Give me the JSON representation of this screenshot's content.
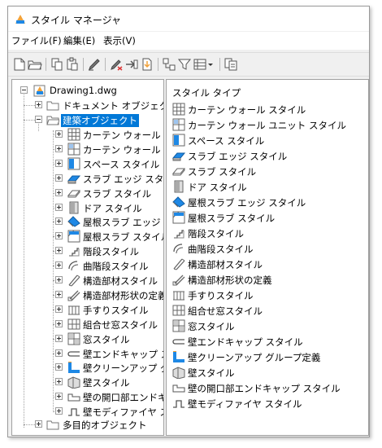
{
  "window": {
    "title": "スタイル マネージャ"
  },
  "menu": {
    "items": [
      "ファイル(F)",
      "編集(E)",
      "表示(V)"
    ]
  },
  "toolbar": {
    "buttons": [
      "new-icon",
      "open-icon",
      "copy-icon",
      "paste-icon",
      "edit-style-icon",
      "purge-icon",
      "send-icon",
      "import-icon",
      "toggle-view-icon",
      "filter-icon",
      "view-mode-icon",
      "dropdown-icon",
      "properties-icon"
    ]
  },
  "tree": {
    "root": "Drawing1.dwg",
    "document_objects": "ドキュメント オブジェクト",
    "architectural_objects": "建築オブジェクト",
    "children": [
      "カーテン ウォール スタイル",
      "カーテン ウォール ユニット",
      "スペース スタイル",
      "スラブ エッジ スタイル",
      "スラブ スタイル",
      "ドア スタイル",
      "屋根スラブ エッジ スタイル",
      "屋根スラブ スタイル",
      "階段スタイル",
      "曲階段スタイル",
      "構造部材スタイル",
      "構造部材形状の定義",
      "手すりスタイル",
      "組合せ窓スタイル",
      "窓スタイル",
      "壁エンドキャップ スタイル",
      "壁クリーンアップ グループ",
      "壁スタイル",
      "壁の開口部エンドキャップ",
      "壁モディファイヤ スタイル"
    ],
    "multipurpose_objects": "多目的オブジェクト"
  },
  "style_list": {
    "header": "スタイル タイプ",
    "items": [
      "カーテン ウォール スタイル",
      "カーテン ウォール ユニット スタイル",
      "スペース スタイル",
      "スラブ エッジ スタイル",
      "スラブ スタイル",
      "ドア スタイル",
      "屋根スラブ エッジ スタイル",
      "屋根スラブ スタイル",
      "階段スタイル",
      "曲階段スタイル",
      "構造部材スタイル",
      "構造部材形状の定義",
      "手すりスタイル",
      "組合せ窓スタイル",
      "窓スタイル",
      "壁エンドキャップ スタイル",
      "壁クリーンアップ グループ定義",
      "壁スタイル",
      "壁の開口部エンドキャップ スタイル",
      "壁モディファイヤ スタイル"
    ]
  },
  "icons": [
    "curtain-wall-icon",
    "curtain-wall-unit-icon",
    "space-icon",
    "slab-edge-icon",
    "slab-icon",
    "door-icon",
    "roof-slab-edge-icon",
    "roof-slab-icon",
    "stair-icon",
    "curved-stair-icon",
    "member-icon",
    "member-shape-icon",
    "railing-icon",
    "window-assembly-icon",
    "window-icon",
    "wall-endcap-icon",
    "wall-cleanup-icon",
    "wall-icon",
    "opening-endcap-icon",
    "wall-modifier-icon"
  ],
  "colors": {
    "selection": "#0078d7",
    "accent_blue": "#1e88e5",
    "accent_orange": "#f2a23a"
  }
}
